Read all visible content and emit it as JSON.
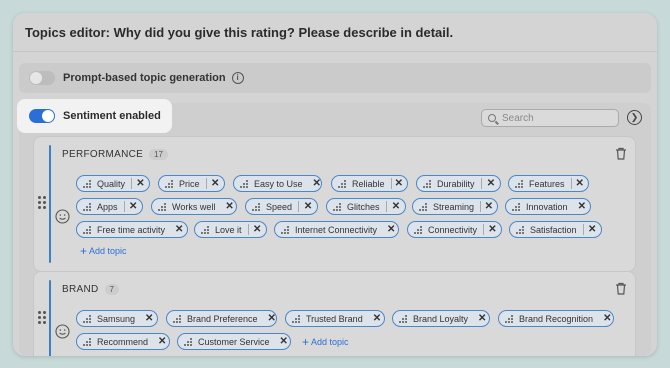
{
  "title": "Topics editor: Why did you give this rating? Please describe in detail.",
  "prompt_toggle": {
    "label": "Prompt-based topic generation",
    "enabled": false
  },
  "sentiment_toggle": {
    "label": "Sentiment enabled",
    "enabled": true
  },
  "search": {
    "placeholder": "Search"
  },
  "colors": {
    "accent": "#2b6fd6",
    "chip_border": "#4a87c9",
    "section_bar": "#3b82c4"
  },
  "add_topic_label": "Add topic",
  "sections": [
    {
      "name": "PERFORMANCE",
      "count": "17",
      "topics": [
        "Quality",
        "Price",
        "Easy to Use",
        "Reliable",
        "Durability",
        "Features",
        "Apps",
        "Works well",
        "Speed",
        "Glitches",
        "Streaming",
        "Innovation",
        "Free time activity",
        "Love it",
        "Internet Connectivity",
        "Connectivity",
        "Satisfaction"
      ]
    },
    {
      "name": "BRAND",
      "count": "7",
      "topics": [
        "Samsung",
        "Brand Preference",
        "Trusted Brand",
        "Brand Loyalty",
        "Brand Recognition",
        "Recommend",
        "Customer Service"
      ]
    }
  ]
}
